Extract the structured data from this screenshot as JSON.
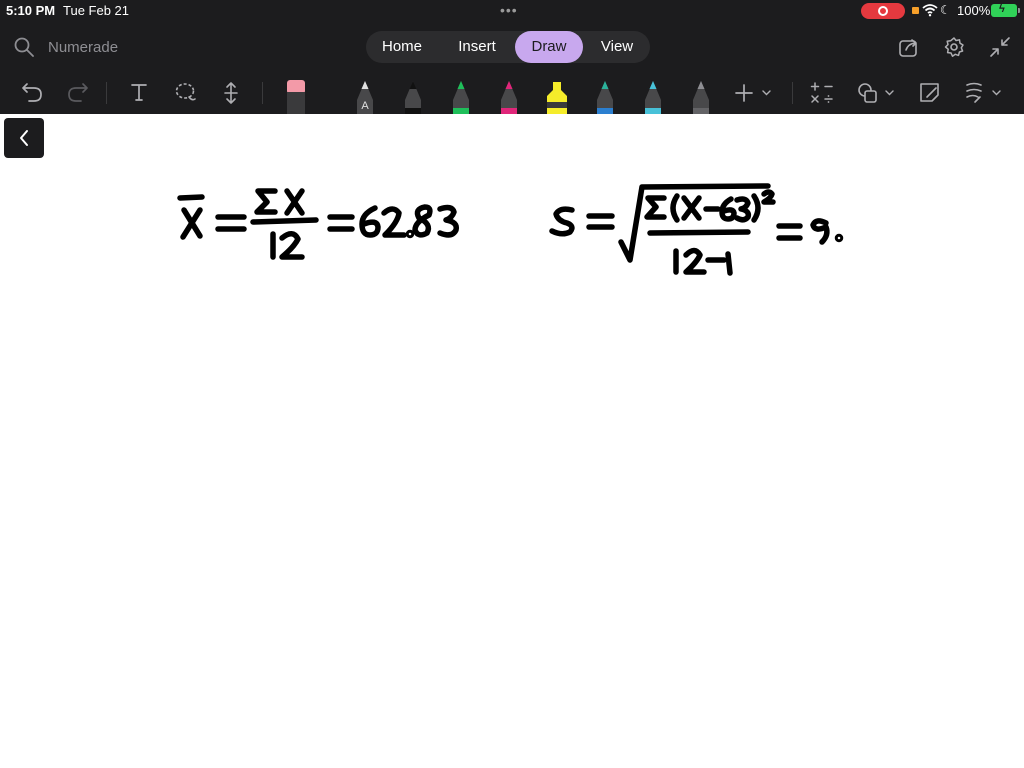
{
  "status_bar": {
    "time": "5:10 PM",
    "date": "Tue Feb 21",
    "battery_percent": "100%",
    "battery_level": 1.0,
    "recording": true,
    "colors": {
      "recording": "#e5393f",
      "battery": "#30d158"
    }
  },
  "toolbar": {
    "search_placeholder": "Numerade",
    "tabs": [
      {
        "label": "Home",
        "active": false
      },
      {
        "label": "Insert",
        "active": false
      },
      {
        "label": "Draw",
        "active": true
      },
      {
        "label": "View",
        "active": false
      }
    ],
    "active_tab_color": "#c8a8ee",
    "right_icons": [
      "share-icon",
      "settings-icon",
      "collapse-icon"
    ]
  },
  "tools": {
    "items": [
      "undo-icon",
      "redo-icon",
      "text-tool-icon",
      "lasso-icon",
      "add-space-icon",
      "eraser-icon",
      "pen-with-text-icon",
      "pen-black-icon",
      "pen-green-icon",
      "pen-magenta-icon",
      "highlighter-yellow-icon",
      "pen-teal-icon",
      "pen-cyan-icon",
      "pen-gray-icon",
      "add-tool-icon",
      "math-icon",
      "shapes-icon",
      "sticky-note-icon",
      "ink-to-shape-icon"
    ],
    "pen_colors": [
      "#e0e0e0",
      "#111111",
      "#1fbf5a",
      "#e0267a",
      "#f5ec2a",
      "#2bb19a",
      "#48c1d8",
      "#8e8e93"
    ]
  },
  "canvas": {
    "handwriting": {
      "mean_formula": {
        "variable": "x̄",
        "numerator": "ΣX",
        "denominator": "12",
        "result": "=62.83"
      },
      "sd_formula": {
        "variable": "s",
        "numerator": "Σ(X−63)²",
        "denominator": "12−1",
        "result": "=9."
      }
    }
  }
}
